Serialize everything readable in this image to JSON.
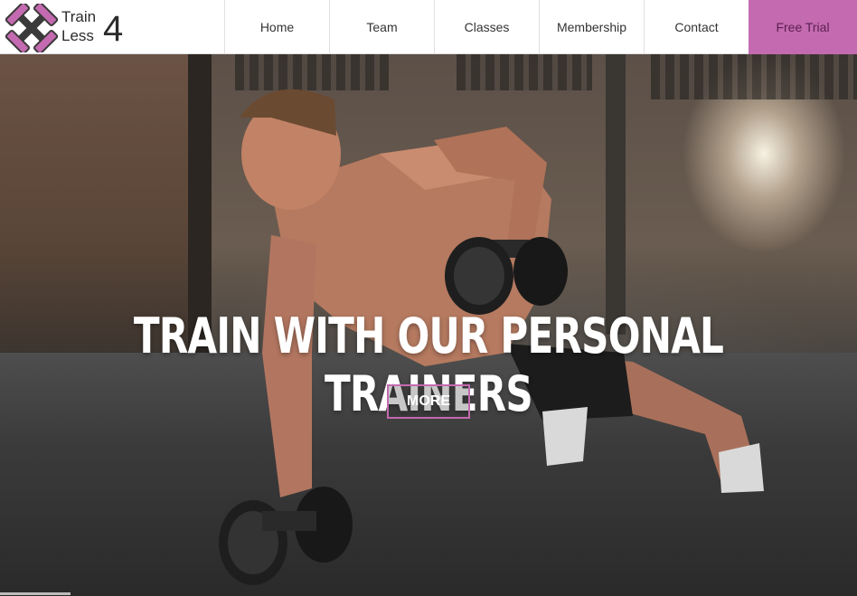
{
  "brand": {
    "line1": "Train",
    "line2": "Less",
    "number": "4",
    "icon": "crossed-dumbbells-icon",
    "colors": {
      "pink": "#c46ab0",
      "dark": "#3a3a3a"
    }
  },
  "nav": {
    "items": [
      {
        "label": "Home"
      },
      {
        "label": "Team"
      },
      {
        "label": "Classes"
      },
      {
        "label": "Membership"
      },
      {
        "label": "Contact"
      }
    ],
    "cta": {
      "label": "Free Trial",
      "color": "#c46ab0"
    }
  },
  "hero": {
    "title": "TRAIN WITH OUR PERSONAL TRAINERS",
    "button": "MORE",
    "accent": "#c46ab0"
  }
}
